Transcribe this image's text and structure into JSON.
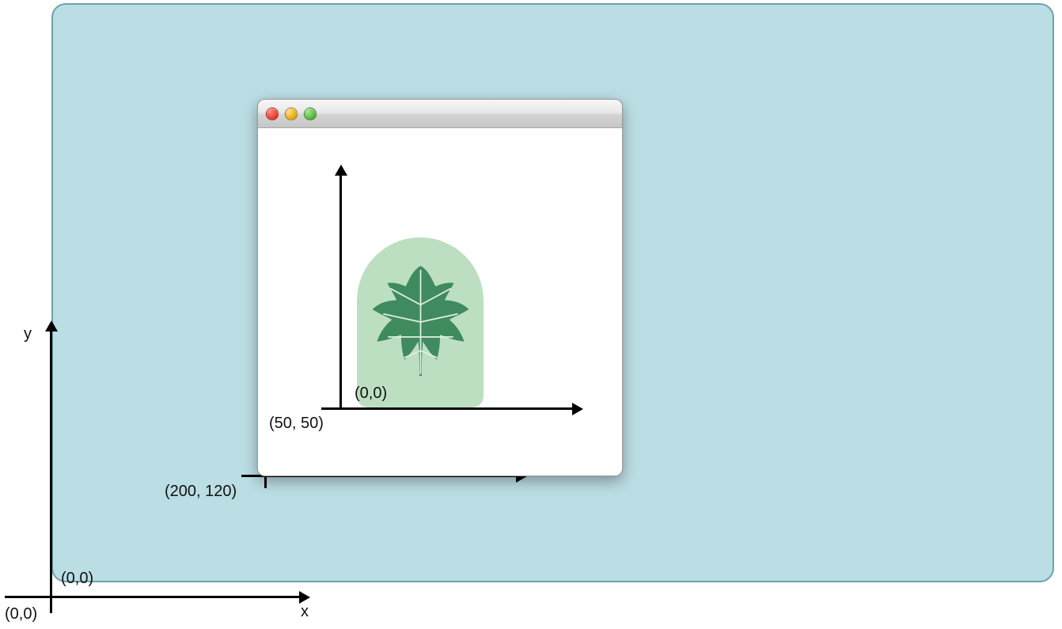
{
  "axes": {
    "y_label": "y",
    "x_label": "x",
    "outer_origin_corner": "(0,0)",
    "screen_origin_inside": "(0,0)",
    "window_origin_inside": "(0,0)",
    "window_origin_screen_coords": "(200, 120)",
    "view_origin_inside": "(0,0)",
    "view_origin_window_coords": "(50, 50)"
  },
  "colors": {
    "screen_panel": "#bbdde4",
    "screen_border": "#6aa3ad",
    "arch_fill": "#bcdfc2",
    "leaf_fill": "#3f8b5f",
    "leaf_vein": "#dff0e4"
  },
  "window": {
    "traffic_lights": [
      "close",
      "minimize",
      "zoom"
    ]
  }
}
